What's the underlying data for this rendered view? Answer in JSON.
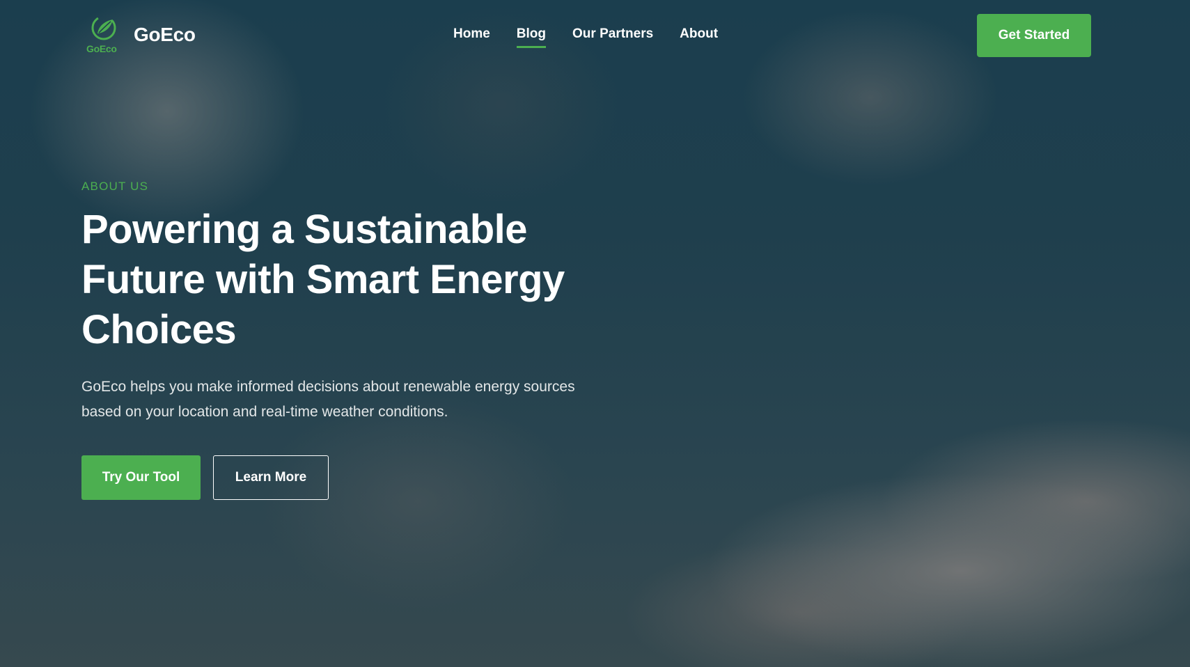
{
  "brand": {
    "logo_text": "GoEco",
    "name": "GoEco",
    "logo_icon": "leaf-circle-icon"
  },
  "nav": {
    "items": [
      {
        "label": "Home",
        "active": false
      },
      {
        "label": "Blog",
        "active": true
      },
      {
        "label": "Our Partners",
        "active": false
      },
      {
        "label": "About",
        "active": false
      }
    ],
    "cta_label": "Get Started"
  },
  "hero": {
    "eyebrow": "ABOUT US",
    "title_line1": "Powering a Sustainable",
    "title_line2": "Future with Smart Energy",
    "title_line3": "Choices",
    "description": "GoEco helps you make informed decisions about renewable energy sources based on your location and real-time weather conditions.",
    "primary_button": "Try Our Tool",
    "secondary_button": "Learn More"
  },
  "colors": {
    "accent": "#4caf50",
    "text": "#ffffff",
    "background": "#1f3f4d"
  }
}
